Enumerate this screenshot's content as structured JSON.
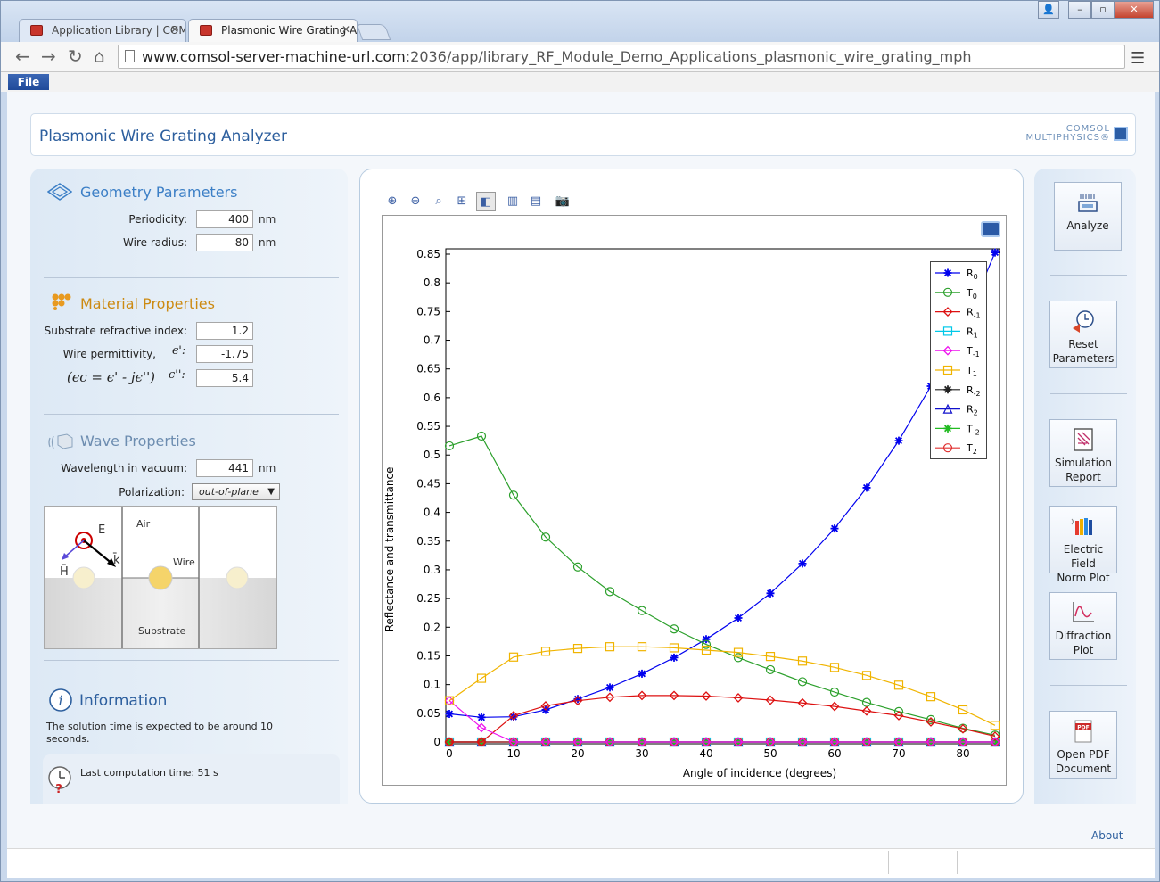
{
  "browser": {
    "tabs": [
      {
        "label": "Application Library | COM"
      },
      {
        "label": "Plasmonic Wire Grating A"
      }
    ],
    "url_host": "www.comsol-server-machine-url.com",
    "url_path": ":2036/app/library_RF_Module_Demo_Applications_plasmonic_wire_grating_mph"
  },
  "menu": {
    "file": "File"
  },
  "app": {
    "title": "Plasmonic Wire Grating Analyzer",
    "logo_line1": "COMSOL",
    "logo_line2": "MULTIPHYSICS®"
  },
  "geometry": {
    "title": "Geometry Parameters",
    "periodicity_label": "Periodicity:",
    "periodicity_value": "400",
    "periodicity_unit": "nm",
    "radius_label": "Wire radius:",
    "radius_value": "80",
    "radius_unit": "nm"
  },
  "material": {
    "title": "Material Properties",
    "substrate_label": "Substrate refractive index:",
    "substrate_value": "1.2",
    "permittivity_label": "Wire permittivity,",
    "eps1_symbol": "ϵ':",
    "eps1_value": "-1.75",
    "formula": "(ϵc = ϵ' - jϵ'')",
    "eps2_symbol": "ϵ'':",
    "eps2_value": "5.4"
  },
  "wave": {
    "title": "Wave Properties",
    "wavelength_label": "Wavelength in vacuum:",
    "wavelength_value": "441",
    "wavelength_unit": "nm",
    "polarization_label": "Polarization:",
    "polarization_value": "out-of-plane",
    "schematic": {
      "e_label": "Ē",
      "h_label": "H̄",
      "k_label": "k̄",
      "air": "Air",
      "wire": "Wire",
      "substrate": "Substrate"
    }
  },
  "information": {
    "title": "Information",
    "text": "The solution time is expected to be around 10 seconds.",
    "last_time": "Last computation time: 51 s"
  },
  "buttons": {
    "analyze": "Analyze",
    "reset": [
      "Reset",
      "Parameters"
    ],
    "report": [
      "Simulation",
      "Report"
    ],
    "efield": [
      "Electric Field",
      "Norm Plot"
    ],
    "diffraction": [
      "Diffraction",
      "Plot"
    ],
    "pdf": [
      "Open PDF",
      "Document"
    ],
    "about": "About"
  },
  "colors": {
    "accent": "#2d5f9e",
    "R0": "#0000ee",
    "T0": "#2ca02c",
    "Rm1": "#dd1111",
    "T1": "#f0b400"
  },
  "chart_data": {
    "type": "line",
    "xlabel": "Angle of incidence (degrees)",
    "ylabel": "Reflectance and transmittance",
    "xlim": [
      0,
      85
    ],
    "ylim": [
      0,
      0.86
    ],
    "xticks": [
      "0",
      "10",
      "20",
      "30",
      "40",
      "50",
      "60",
      "70",
      "80"
    ],
    "yticks": [
      "0",
      "0.05",
      "0.1",
      "0.15",
      "0.2",
      "0.25",
      "0.3",
      "0.35",
      "0.4",
      "0.45",
      "0.5",
      "0.55",
      "0.6",
      "0.65",
      "0.7",
      "0.75",
      "0.8",
      "0.85"
    ],
    "grid": true,
    "legend_position": "top-right",
    "x": [
      0,
      5,
      10,
      15,
      20,
      25,
      30,
      35,
      40,
      45,
      50,
      55,
      60,
      65,
      70,
      75,
      80,
      85
    ],
    "series": [
      {
        "name": "R0",
        "label_main": "R",
        "label_sub": "0",
        "color": "#0000ee",
        "marker": "star",
        "values": [
          0.049,
          0.043,
          0.044,
          0.056,
          0.075,
          0.095,
          0.119,
          0.147,
          0.179,
          0.216,
          0.259,
          0.311,
          0.372,
          0.443,
          0.525,
          0.62,
          0.72,
          0.853
        ]
      },
      {
        "name": "T0",
        "label_main": "T",
        "label_sub": "0",
        "color": "#2ca02c",
        "marker": "circle",
        "values": [
          0.516,
          0.533,
          0.43,
          0.357,
          0.305,
          0.262,
          0.229,
          0.197,
          0.17,
          0.147,
          0.126,
          0.105,
          0.087,
          0.069,
          0.053,
          0.039,
          0.024,
          0.012
        ]
      },
      {
        "name": "R-1",
        "label_main": "R",
        "label_sub": "-1",
        "color": "#dd1111",
        "marker": "diamond",
        "values": [
          0,
          0,
          0.046,
          0.063,
          0.072,
          0.078,
          0.081,
          0.081,
          0.08,
          0.077,
          0.073,
          0.068,
          0.062,
          0.054,
          0.046,
          0.035,
          0.023,
          0.01
        ]
      },
      {
        "name": "R1",
        "label_main": "R",
        "label_sub": "1",
        "color": "#00c8e8",
        "marker": "square",
        "values": [
          0,
          0,
          0,
          0,
          0,
          0,
          0,
          0,
          0,
          0,
          0,
          0,
          0,
          0,
          0,
          0,
          0,
          0
        ]
      },
      {
        "name": "T-1",
        "label_main": "T",
        "label_sub": "-1",
        "color": "#ee11ee",
        "marker": "diamond",
        "values": [
          0.072,
          0.025,
          0,
          0,
          0,
          0,
          0,
          0,
          0,
          0,
          0,
          0,
          0,
          0,
          0,
          0,
          0,
          0
        ]
      },
      {
        "name": "T1",
        "label_main": "T",
        "label_sub": "1",
        "color": "#f0b400",
        "marker": "square",
        "values": [
          0.072,
          0.111,
          0.148,
          0.158,
          0.163,
          0.166,
          0.166,
          0.164,
          0.16,
          0.156,
          0.149,
          0.141,
          0.13,
          0.116,
          0.099,
          0.079,
          0.056,
          0.029
        ]
      },
      {
        "name": "R-2",
        "label_main": "R",
        "label_sub": "-2",
        "color": "#222222",
        "marker": "star",
        "values": [
          0,
          0,
          0,
          0,
          0,
          0,
          0,
          0,
          0,
          0,
          0,
          0,
          0,
          0,
          0,
          0,
          0,
          0
        ]
      },
      {
        "name": "R2",
        "label_main": "R",
        "label_sub": "2",
        "color": "#1010cc",
        "marker": "triangle",
        "values": [
          0,
          0,
          0,
          0,
          0,
          0,
          0,
          0,
          0,
          0,
          0,
          0,
          0,
          0,
          0,
          0,
          0,
          0
        ]
      },
      {
        "name": "T-2",
        "label_main": "T",
        "label_sub": "-2",
        "color": "#22bb22",
        "marker": "star",
        "values": [
          0,
          0,
          0,
          0,
          0,
          0,
          0,
          0,
          0,
          0,
          0,
          0,
          0,
          0,
          0,
          0,
          0,
          0
        ]
      },
      {
        "name": "T2",
        "label_main": "T",
        "label_sub": "2",
        "color": "#e03030",
        "marker": "circle",
        "values": [
          0,
          0,
          0,
          0,
          0,
          0,
          0,
          0,
          0,
          0,
          0,
          0,
          0,
          0,
          0,
          0,
          0,
          0
        ]
      }
    ]
  }
}
